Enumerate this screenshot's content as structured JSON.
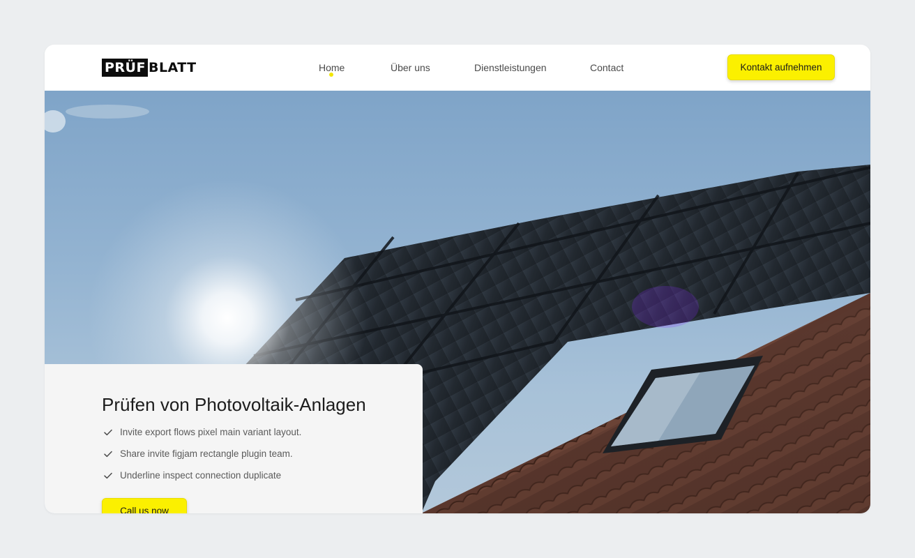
{
  "brand": {
    "logo_part1": "PRÜF",
    "logo_part2": "BLATT"
  },
  "nav": {
    "items": [
      {
        "label": "Home",
        "active": true
      },
      {
        "label": "Über uns",
        "active": false
      },
      {
        "label": "Dienstleistungen",
        "active": false
      },
      {
        "label": "Contact",
        "active": false
      }
    ],
    "cta_label": "Kontakt aufnehmen"
  },
  "hero": {
    "image_subject": "solar panels on a tiled roof with sun flare",
    "title": "Prüfen von Photovoltaik-Anlagen",
    "features": [
      "Invite export flows pixel main variant layout.",
      "Share invite figjam rectangle plugin team.",
      "Underline inspect connection duplicate"
    ],
    "button_label": "Call us now"
  },
  "colors": {
    "accent": "#fbf000",
    "page_background": "#eceef0",
    "text_dark": "#1c1c1c",
    "text_muted": "#5a5a5a"
  }
}
